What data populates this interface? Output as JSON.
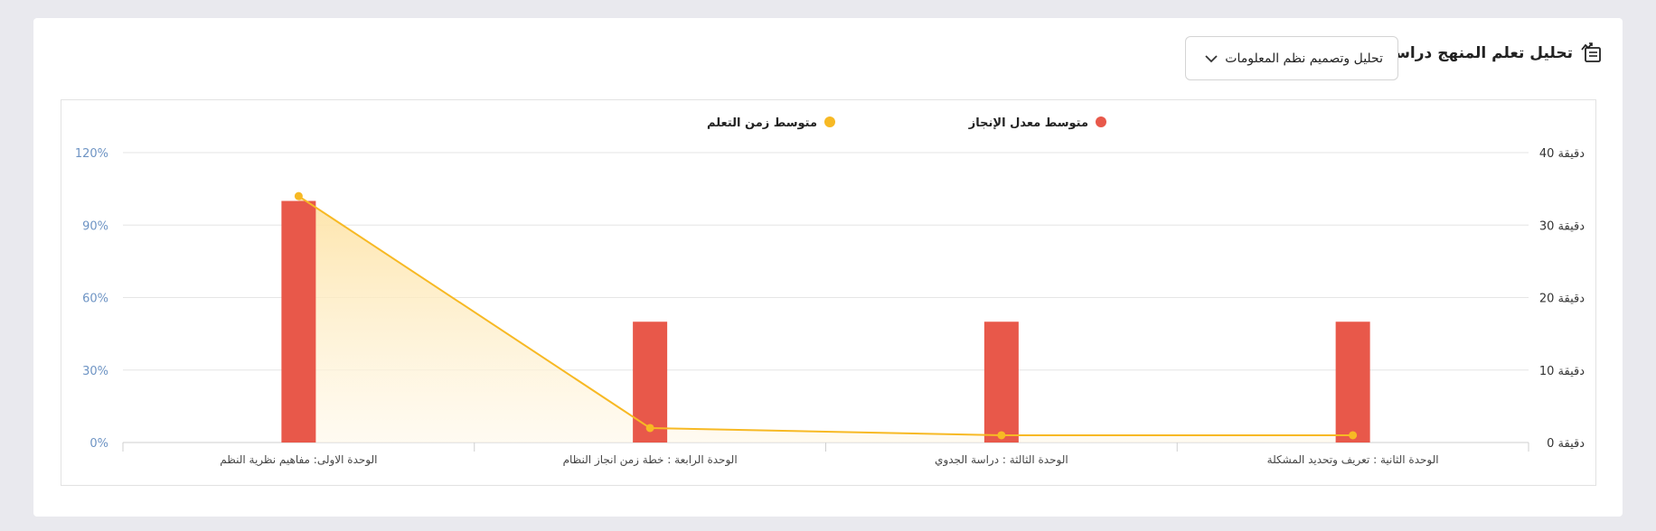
{
  "header": {
    "title": "تحليل تعلم المنهج دراسي",
    "icon": "chart-report-icon"
  },
  "course_select": {
    "selected": "تحليل وتصميم نظم المعلومات",
    "icon": "chevron-down-icon"
  },
  "chart_data": {
    "type": "bar",
    "categories": [
      "الوحدة الاولى: مفاهيم نظرية النظم",
      "الوحدة الرابعة : خطة زمن انجاز النظام",
      "الوحدة الثالثة : دراسة الجدوي",
      "الوحدة الثانية : تعريف وتحديد المشكلة"
    ],
    "series": [
      {
        "name": "متوسط معدل الإنجاز",
        "type": "bar",
        "axis": "left",
        "color": "#e8584a",
        "values": [
          100,
          50,
          50,
          50
        ]
      },
      {
        "name": "متوسط زمن التعلم",
        "type": "line",
        "axis": "right",
        "color": "#f7b924",
        "values": [
          34,
          2,
          1,
          1
        ]
      }
    ],
    "left_axis": {
      "ylim": [
        0,
        120
      ],
      "ticks": [
        "0%",
        "30%",
        "60%",
        "90%",
        "120%"
      ]
    },
    "right_axis": {
      "ylim": [
        0,
        40
      ],
      "ticks": [
        "دقيقة 0",
        "دقيقة 10",
        "دقيقة 20",
        "دقيقة 30",
        "دقيقة 40"
      ]
    },
    "legend_position": "top-center",
    "grid": true
  }
}
